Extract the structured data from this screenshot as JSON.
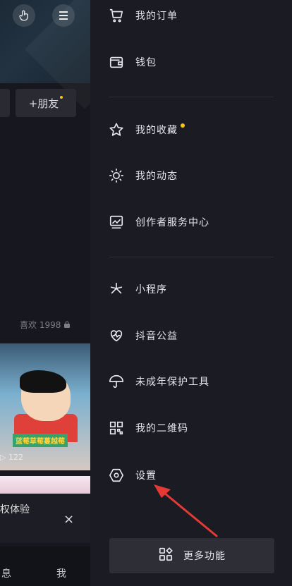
{
  "left": {
    "add_friend": "+朋友",
    "favorites_text": "喜欢 1998",
    "thumb_caption": "蓝莓草莓蔓越莓",
    "play_count": "122",
    "notice_text": "权体验",
    "close_symbol": "×",
    "bottom_nav": [
      "息",
      "我"
    ]
  },
  "drawer": {
    "items": [
      {
        "label": "我的订单",
        "icon": "cart-icon"
      },
      {
        "label": "钱包",
        "icon": "wallet-icon"
      },
      {
        "label": "我的收藏",
        "icon": "star-icon",
        "has_dot": true
      },
      {
        "label": "我的动态",
        "icon": "sun-icon"
      },
      {
        "label": "创作者服务中心",
        "icon": "monitor-chart-icon"
      },
      {
        "label": "小程序",
        "icon": "asterisk-icon"
      },
      {
        "label": "抖音公益",
        "icon": "heart-pulse-icon"
      },
      {
        "label": "未成年保护工具",
        "icon": "umbrella-icon"
      },
      {
        "label": "我的二维码",
        "icon": "qrcode-icon"
      },
      {
        "label": "设置",
        "icon": "hexagon-settings-icon"
      }
    ],
    "more_button": {
      "label": "更多功能",
      "icon": "grid-plus-icon"
    }
  },
  "colors": {
    "background": "#15161d",
    "drawer": "#1b1c23",
    "badge_dot": "#f5c518",
    "annotation_arrow": "#e53935"
  }
}
